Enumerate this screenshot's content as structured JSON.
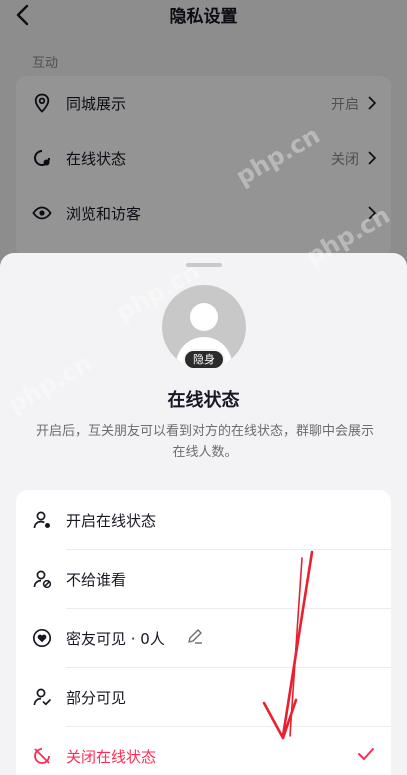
{
  "nav": {
    "title": "隐私设置"
  },
  "section": {
    "title": "互动"
  },
  "privacy_rows": [
    {
      "label": "同城展示",
      "value": "开启"
    },
    {
      "label": "在线状态",
      "value": "关闭"
    },
    {
      "label": "浏览和访客",
      "value": ""
    }
  ],
  "sheet": {
    "badge": "隐身",
    "title": "在线状态",
    "description": "开启后，互关朋友可以看到对方的在线状态，群聊中会展示在线人数。",
    "options": [
      {
        "label": "开启在线状态",
        "icon": "user-online-icon"
      },
      {
        "label": "不给谁看",
        "icon": "user-block-icon"
      },
      {
        "label": "密友可见 · 0人",
        "icon": "heart-shield-icon"
      },
      {
        "label": "部分可见",
        "icon": "user-check-icon"
      },
      {
        "label": "关闭在线状态",
        "icon": "eye-off-icon",
        "selected": true
      }
    ]
  },
  "watermark": "php.cn",
  "colors": {
    "accent": "#fe2c55",
    "annotation_arrow": "#e8202f"
  }
}
